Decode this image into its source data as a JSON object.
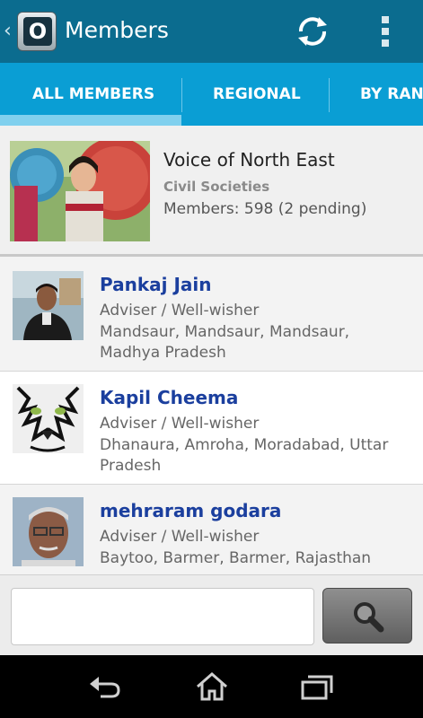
{
  "app": {
    "title": "Members",
    "logo_letter": "O",
    "icons": {
      "back": "chevron-left-icon",
      "refresh": "refresh-icon",
      "menu": "overflow-menu-icon"
    }
  },
  "tabs": [
    {
      "label": "ALL MEMBERS",
      "selected": true
    },
    {
      "label": "REGIONAL",
      "selected": false
    },
    {
      "label": "BY RAN",
      "selected": false
    }
  ],
  "group": {
    "name": "Voice of North East",
    "type": "Civil Societies",
    "members": "Members: 598 (2 pending)"
  },
  "members": [
    {
      "name": "Pankaj Jain",
      "role": "Adviser / Well-wisher",
      "location": "Mandsaur, Mandsaur, Mandsaur, Madhya Pradesh"
    },
    {
      "name": "Kapil Cheema",
      "role": "Adviser / Well-wisher",
      "location": "Dhanaura, Amroha, Moradabad, Uttar Pradesh"
    },
    {
      "name": "mehraram godara",
      "role": "Adviser / Well-wisher",
      "location": "Baytoo, Barmer, Barmer, Rajasthan"
    }
  ],
  "search": {
    "value": "",
    "placeholder": "",
    "icon": "search-icon"
  },
  "nav": {
    "icons": [
      "back-icon",
      "home-icon",
      "recent-apps-icon"
    ]
  },
  "colors": {
    "actionbar": "#0b6c8f",
    "tabs": "#0a9ed4",
    "member_name": "#1b3f9e"
  }
}
